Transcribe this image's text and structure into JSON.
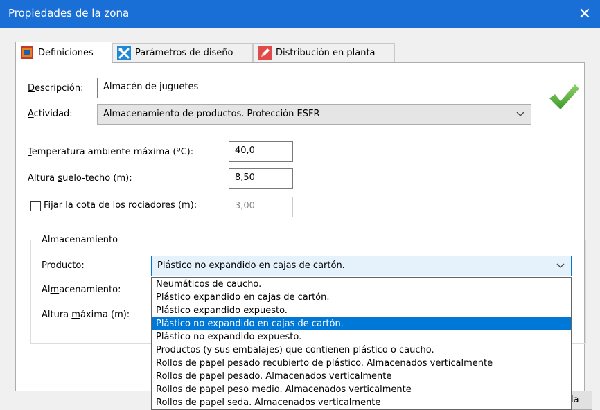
{
  "window": {
    "title": "Propiedades de la zona",
    "close_symbol": "✕",
    "title_bar_color": "#1a6fd6"
  },
  "tabs": [
    {
      "label": "Definiciones",
      "icon": "zone-icon",
      "active": true
    },
    {
      "label": "Parámetros de diseño",
      "icon": "tools-icon",
      "active": false
    },
    {
      "label": "Distribución en planta",
      "icon": "pencil-icon",
      "active": false
    }
  ],
  "form": {
    "descripcion": {
      "label_u": "D",
      "label_rest": "escripción:",
      "value": "Almacén de juguetes"
    },
    "actividad": {
      "label_u": "A",
      "label_rest": "ctividad:",
      "value": "Almacenamiento de productos. Protección ESFR"
    },
    "temperatura": {
      "label_u": "T",
      "label_rest": "emperatura ambiente máxima (ºC):",
      "value": "40,0"
    },
    "altura": {
      "label_pre": "Altura ",
      "label_u": "s",
      "label_rest": "uelo-techo (m):",
      "value": "8,50"
    },
    "rociadores": {
      "label": "Fijar la cota de los rociadores (m):",
      "value": "3,00",
      "checked": false
    },
    "status_icon": "checkmark-icon"
  },
  "almacenamiento": {
    "group_title": "Almacenamiento",
    "producto": {
      "label_pre": "",
      "label_u": "P",
      "label_rest": "roducto:",
      "value": "Plástico no expandido en cajas de cartón."
    },
    "almacenamiento": {
      "label_pre": "Al",
      "label_u": "m",
      "label_rest": "acenamiento:"
    },
    "altura_maxima": {
      "label_pre": "Altura ",
      "label_u": "m",
      "label_rest": "áxima (m):"
    }
  },
  "dropdown": {
    "options": [
      "Neumáticos de caucho.",
      "Plástico expandido en cajas de cartón.",
      "Plástico expandido expuesto.",
      "Plástico no expandido en cajas de cartón.",
      "Plástico no expandido expuesto.",
      "Productos (y sus embalajes) que contienen plástico o caucho.",
      "Rollos de papel pesado recubierto de plástico. Almacenados verticalmente",
      "Rollos de papel pesado. Almacenados verticalmente",
      "Rollos de papel peso medio. Almacenados verticalmente",
      "Rollos de papel seda. Almacenados verticalmente"
    ],
    "selected_index": 3,
    "selection_color": "#0078d7"
  },
  "footer": {
    "partial_button_label": "la"
  }
}
